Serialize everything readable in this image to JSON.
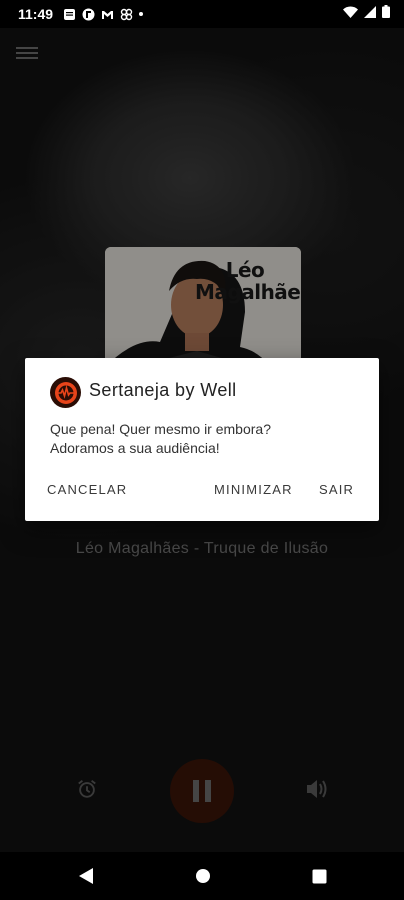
{
  "status_bar": {
    "time": "11:49",
    "icons": [
      "message-icon",
      "flipboard-icon",
      "gmail-icon",
      "pinwheel-icon",
      "dot-icon"
    ],
    "right_icons": [
      "wifi-icon",
      "signal-icon",
      "battery-icon"
    ]
  },
  "player": {
    "album": {
      "artist_text": "Léo Magalhães",
      "subtitle": ""
    },
    "track_title": "",
    "track_artist": "Léo Magalhães - Truque de Ilusão",
    "controls": {
      "alarm_icon": "alarm-icon",
      "play_state": "playing",
      "pause_icon": "pause-icon",
      "volume_icon": "volume-icon"
    }
  },
  "dialog": {
    "title": "Sertaneja by Well",
    "message_line1": "Que pena! Quer mesmo ir embora?",
    "message_line2": "Adoramos a sua audiência!",
    "buttons": {
      "cancel": "CANCELAR",
      "minimize": "MINIMIZAR",
      "exit": "SAIR"
    }
  },
  "colors": {
    "accent": "#e8441a",
    "play_button_bg": "#3a1408",
    "dialog_bg": "#ffffff"
  }
}
